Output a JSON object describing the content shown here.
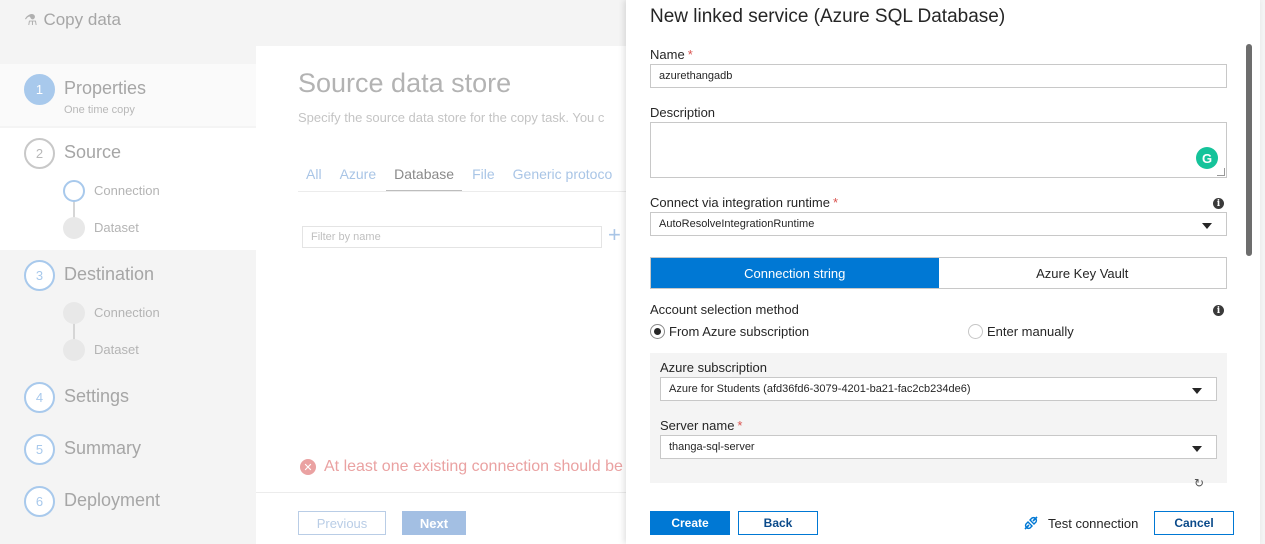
{
  "background": {
    "app_title": "Copy data",
    "steps": [
      {
        "num": "1",
        "label": "Properties",
        "sub": "One time copy"
      },
      {
        "num": "2",
        "label": "Source",
        "substeps": [
          "Connection",
          "Dataset"
        ]
      },
      {
        "num": "3",
        "label": "Destination",
        "substeps": [
          "Connection",
          "Dataset"
        ]
      },
      {
        "num": "4",
        "label": "Settings"
      },
      {
        "num": "5",
        "label": "Summary"
      },
      {
        "num": "6",
        "label": "Deployment"
      }
    ],
    "main": {
      "title": "Source data store",
      "description": "Specify the source data store for the copy task. You c",
      "tabs": [
        "All",
        "Azure",
        "Database",
        "File",
        "Generic protoco"
      ],
      "selected_tab": "Database",
      "filter_placeholder": "Filter by name",
      "error": "At least one existing connection should be"
    },
    "footer": {
      "previous": "Previous",
      "next": "Next"
    }
  },
  "panel": {
    "title": "New linked service (Azure SQL Database)",
    "name_label": "Name",
    "name_value": "azurethangadb",
    "description_label": "Description",
    "runtime_label": "Connect via integration runtime",
    "runtime_value": "AutoResolveIntegrationRuntime",
    "segment": [
      "Connection string",
      "Azure Key Vault"
    ],
    "account_label": "Account selection method",
    "radio_options": [
      "From Azure subscription",
      "Enter manually"
    ],
    "subscription_label": "Azure subscription",
    "subscription_value": "Azure for Students (afd36fd6-3079-4201-ba21-fac2cb234de6)",
    "server_label": "Server name",
    "server_value": "thanga-sql-server",
    "required_mark": "*",
    "info_glyph": "i",
    "grammarly_glyph": "G",
    "footer": {
      "create": "Create",
      "back": "Back",
      "test_connection": "Test connection",
      "cancel": "Cancel"
    }
  },
  "colors": {
    "accent": "#0078d4",
    "required": "#d9534f",
    "error": "#eaa2a2"
  }
}
